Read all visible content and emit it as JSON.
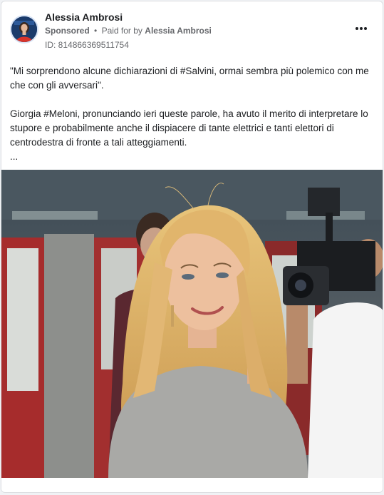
{
  "post": {
    "author": "Alessia Ambrosi",
    "sponsored_label": "Sponsored",
    "paid_for_prefix": "Paid for by",
    "paid_for_by": "Alessia Ambrosi",
    "ad_id": "ID: 814866369511754",
    "paragraph_1": "\"Mi sorprendono alcune dichiarazioni di #Salvini, ormai sembra più polemico con me che con gli avversari\".",
    "paragraph_2": "Giorgia #Meloni, pronunciando ieri queste parole, ha avuto il merito di interpretare lo stupore e probabilmente anche il dispiacere di tante elettrici e tanti elettori di centrodestra di fronte a tali atteggiamenti.",
    "see_more": "...",
    "icons": {
      "options": "more-options-icon",
      "separator": "•"
    },
    "colors": {
      "card_bg": "#ffffff",
      "page_bg": "#f0f2f5",
      "secondary_text": "#65676b"
    }
  }
}
